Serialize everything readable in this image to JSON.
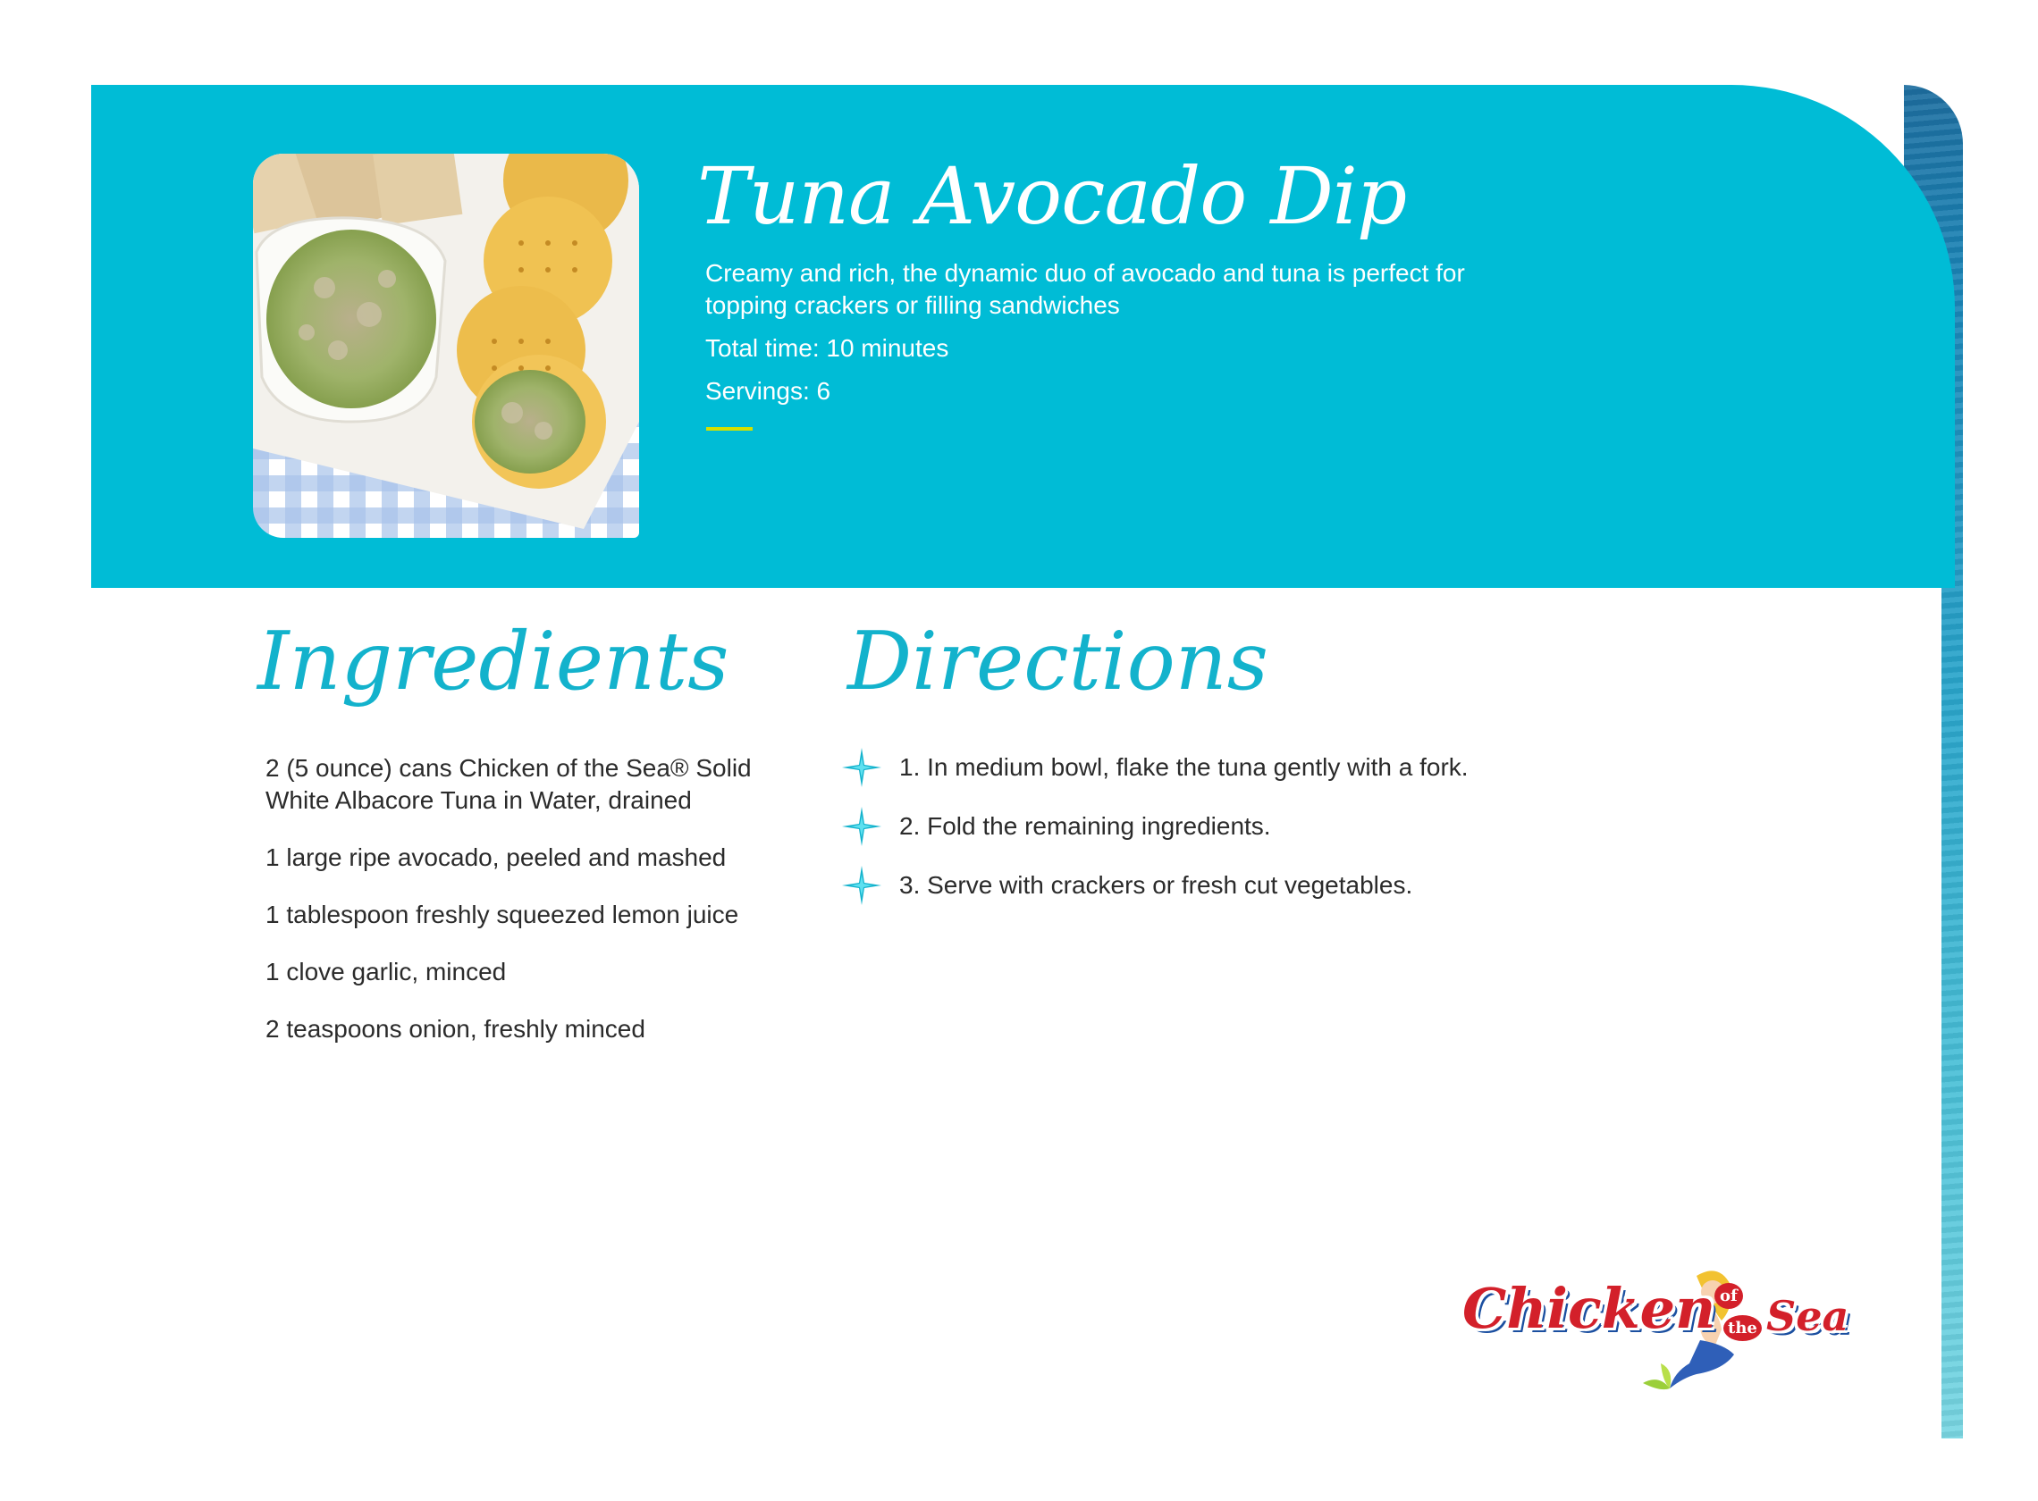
{
  "recipe": {
    "title": "Tuna Avocado Dip",
    "description": "Creamy and rich, the dynamic duo of avocado and tuna is perfect for topping crackers or filling sandwiches",
    "total_time": "Total time: 10 minutes",
    "servings": "Servings: 6"
  },
  "ingredients": {
    "heading": "Ingredients",
    "items": [
      "2 (5 ounce) cans Chicken of the Sea® Solid White Albacore Tuna in Water, drained",
      "1 large ripe avocado, peeled and mashed",
      "1 tablespoon freshly squeezed lemon juice",
      "1 clove garlic, minced",
      "2 teaspoons onion, freshly minced"
    ]
  },
  "directions": {
    "heading": "Directions",
    "steps": [
      "1. In medium bowl, flake the tuna gently with a fork.",
      "2. Fold the remaining ingredients.",
      "3. Serve with crackers or fresh cut vegetables."
    ]
  },
  "brand": {
    "logo_word_1": "Chicken",
    "logo_of": "of",
    "logo_the": "the",
    "logo_word_2": "Sea"
  },
  "colors": {
    "header_bg": "#00bcd6",
    "heading_accent": "#13b2cc",
    "accent_line": "#d4e000",
    "logo_red": "#d3202a"
  },
  "icons": {
    "bullet": "sparkle-star-icon"
  }
}
